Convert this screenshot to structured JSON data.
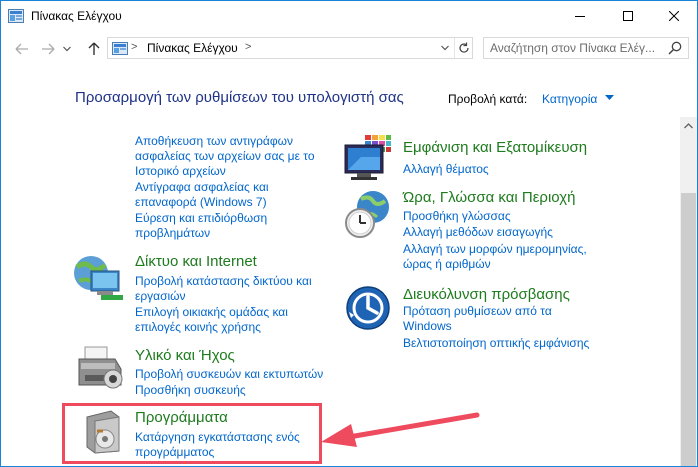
{
  "window": {
    "title": "Πίνακας Ελέγχου"
  },
  "address": {
    "crumb": "Πίνακας Ελέγχου",
    "separator": ">"
  },
  "search": {
    "placeholder": "Αναζήτηση στον Πίνακα Ελέγ..."
  },
  "header": {
    "title": "Προσαρμογή των ρυθμίσεων του υπολογιστή σας",
    "view_by_label": "Προβολή κατά:",
    "view_by_value": "Κατηγορία"
  },
  "left": {
    "system_links": [
      "Αποθήκευση των αντιγράφων",
      "ασφαλείας των αρχείων σας με το",
      "Ιστορικό αρχείων",
      "Αντίγραφα ασφαλείας και",
      "επαναφορά (Windows 7)",
      "Εύρεση και επιδιόρθωση",
      "προβλημάτων"
    ],
    "network": {
      "title": "Δίκτυο και Internet",
      "links": [
        "Προβολή κατάστασης δικτύου και",
        "εργασιών",
        "Επιλογή οικιακής ομάδας και",
        "επιλογές κοινής χρήσης"
      ]
    },
    "hardware": {
      "title": "Υλικό και Ήχος",
      "links": [
        "Προβολή συσκευών και εκτυπωτών",
        "Προσθήκη συσκευής"
      ]
    },
    "programs": {
      "title": "Προγράμματα",
      "links": [
        "Κατάργηση εγκατάστασης ενός",
        "προγράμματος"
      ]
    }
  },
  "right": {
    "appearance": {
      "title": "Εμφάνιση και Εξατομίκευση",
      "links": [
        "Αλλαγή θέματος"
      ]
    },
    "clock": {
      "title": "Ώρα, Γλώσσα και Περιοχή",
      "links": [
        "Προσθήκη γλώσσας",
        "Αλλαγή μεθόδων εισαγωγής",
        "Αλλαγή των μορφών ημερομηνίας,",
        "ώρας ή αριθμών"
      ]
    },
    "access": {
      "title": "Διευκόλυνση πρόσβασης",
      "links": [
        "Πρόταση ρυθμίσεων από τα",
        "Windows",
        "Βελτιστοποίηση οπτικής εμφάνισης"
      ]
    }
  },
  "colors": {
    "link": "#0066cc",
    "category_title": "#1e7b1e",
    "heading": "#1e3287",
    "highlight": "#ef4b5e"
  },
  "icons": {
    "app": "control-panel-icon",
    "back": "back-arrow-icon",
    "forward": "forward-arrow-icon",
    "recent": "chevron-down-icon",
    "up": "up-arrow-icon",
    "refresh": "refresh-icon",
    "search": "search-icon"
  }
}
